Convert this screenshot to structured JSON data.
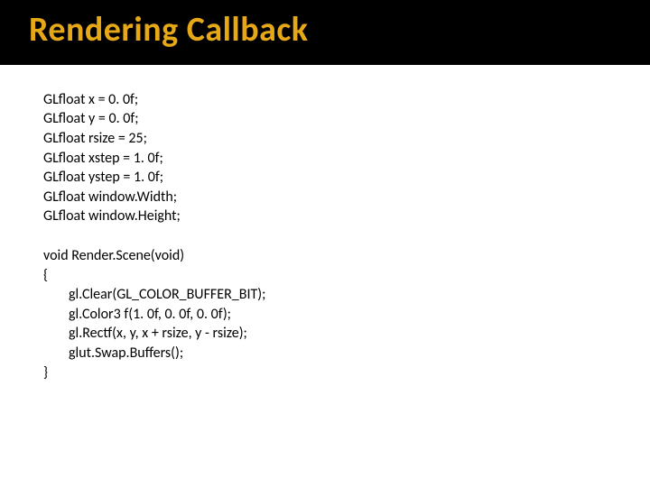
{
  "title": "Rendering Callback",
  "decls": {
    "l1": "GLfloat x = 0. 0f;",
    "l2": "GLfloat y = 0. 0f;",
    "l3": "GLfloat rsize = 25;",
    "l4": "GLfloat xstep = 1. 0f;",
    "l5": "GLfloat ystep = 1. 0f;",
    "l6": "GLfloat window.Width;",
    "l7": "GLfloat window.Height;"
  },
  "func": {
    "sig": "void Render.Scene(void)",
    "open": "{",
    "b1": "gl.Clear(GL_COLOR_BUFFER_BIT);",
    "b2": "gl.Color3 f(1. 0f, 0. 0f, 0. 0f);",
    "b3": "gl.Rectf(x, y, x + rsize, y - rsize);",
    "b4": "glut.Swap.Buffers();",
    "close": "}"
  }
}
